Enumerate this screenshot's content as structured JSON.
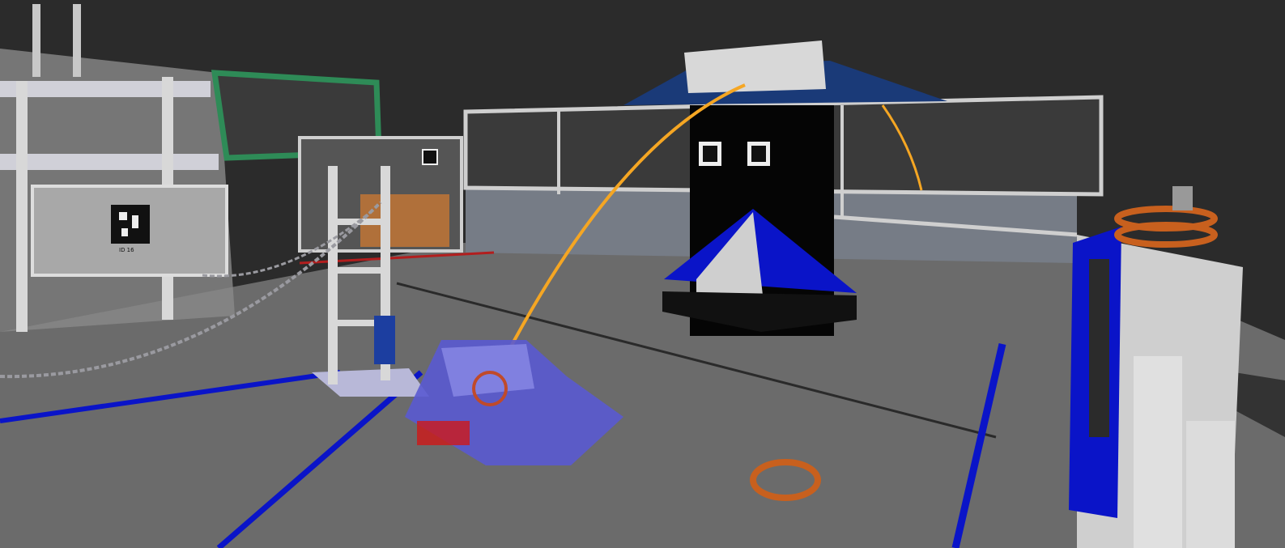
{
  "scene": {
    "apriltag_label": "ID 16"
  },
  "colors": {
    "background": "#2b2b2b",
    "floor": "#6b6b6b",
    "alliance_blue": "#0a14c8",
    "trajectory": "#f5a623",
    "frame_green": "#2e8b57",
    "ring_orange": "#c8601e",
    "robot": "#5a5ad2"
  }
}
